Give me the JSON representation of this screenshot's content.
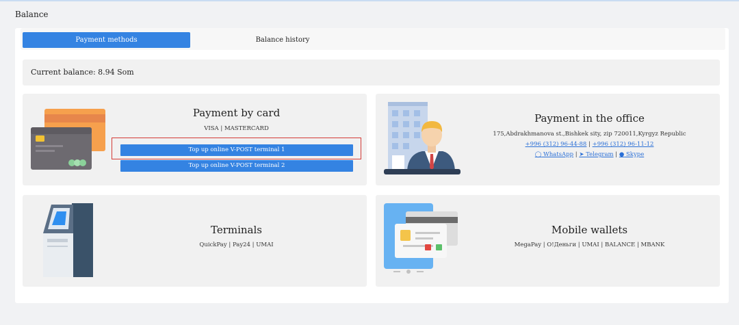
{
  "page": {
    "title": "Balance"
  },
  "tabs": [
    {
      "label": "Payment methods",
      "active": true
    },
    {
      "label": "Balance history",
      "active": false
    }
  ],
  "balance": {
    "text": "Current balance: 8.94 Som"
  },
  "cards": {
    "card_payment": {
      "title": "Payment by card",
      "subtitle": "VISA | MASTERCARD",
      "buttons": [
        "Top up online V-POST terminal 1",
        "Top up online V-POST terminal 2"
      ]
    },
    "office": {
      "title": "Payment in the office",
      "address": "175,Abdrakhmanova st.,Bishkek sity, zip 720011,Kyrgyz Republic",
      "phone1": "+996 (312) 96-44-88",
      "phone_sep": "|",
      "phone2": "+996 (312) 96-11-12",
      "whatsapp": "WhatsApp",
      "telegram": "Telegram",
      "skype": "Skype",
      "sep": "|"
    },
    "terminals": {
      "title": "Terminals",
      "subtitle": "QuickPay | Pay24 | UMAI"
    },
    "wallets": {
      "title": "Mobile wallets",
      "subtitle": "MegaPay | O!Деньги | UMAI | BALANCE | MBANK"
    }
  },
  "icons": {
    "cards": "credit-cards-icon",
    "office": "office-manager-icon",
    "terminal": "payment-terminal-icon",
    "wallet": "mobile-wallet-icon",
    "whatsapp": "whatsapp-icon",
    "telegram": "telegram-icon",
    "skype": "skype-icon"
  },
  "colors": {
    "accent": "#3483e2",
    "highlight": "#d43a36",
    "link": "#2a6fd6"
  }
}
